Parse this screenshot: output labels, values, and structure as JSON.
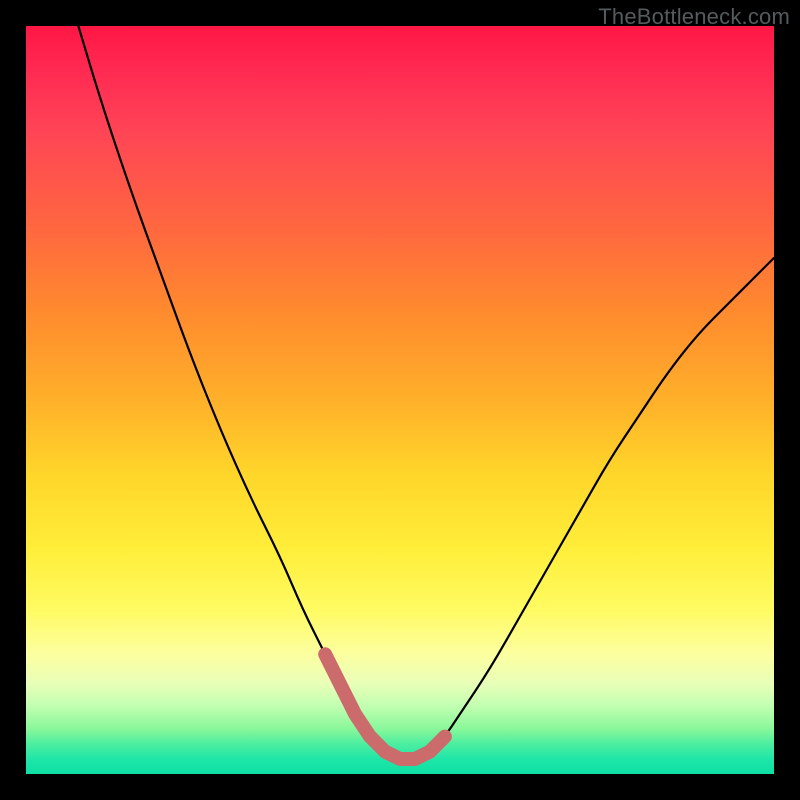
{
  "watermark": "TheBottleneck.com",
  "chart_data": {
    "type": "line",
    "title": "",
    "xlabel": "",
    "ylabel": "",
    "xlim": [
      0,
      100
    ],
    "ylim": [
      0,
      100
    ],
    "grid": false,
    "legend": false,
    "series": [
      {
        "name": "curve",
        "color": "#000000",
        "x": [
          7,
          10,
          14,
          18,
          22,
          26,
          30,
          34,
          37,
          40,
          42,
          44,
          46,
          48,
          50,
          52,
          54,
          56,
          58,
          62,
          66,
          70,
          74,
          78,
          82,
          86,
          90,
          94,
          98,
          100
        ],
        "y": [
          100,
          90,
          78,
          67,
          56,
          46,
          37,
          29,
          22,
          16,
          12,
          8,
          5,
          3,
          2,
          2,
          3,
          5,
          8,
          14,
          21,
          28,
          35,
          42,
          48,
          54,
          59,
          63,
          67,
          69
        ]
      },
      {
        "name": "highlight",
        "color": "#cc6b6b",
        "x": [
          40,
          42,
          44,
          46,
          48,
          50,
          52,
          54,
          56
        ],
        "y": [
          16,
          12,
          8,
          5,
          3,
          2,
          2,
          3,
          5
        ]
      }
    ],
    "background_gradient": {
      "top_color": "#ff1744",
      "bottom_color": "#0ee0a4",
      "meaning": "red=high, green=low"
    }
  }
}
